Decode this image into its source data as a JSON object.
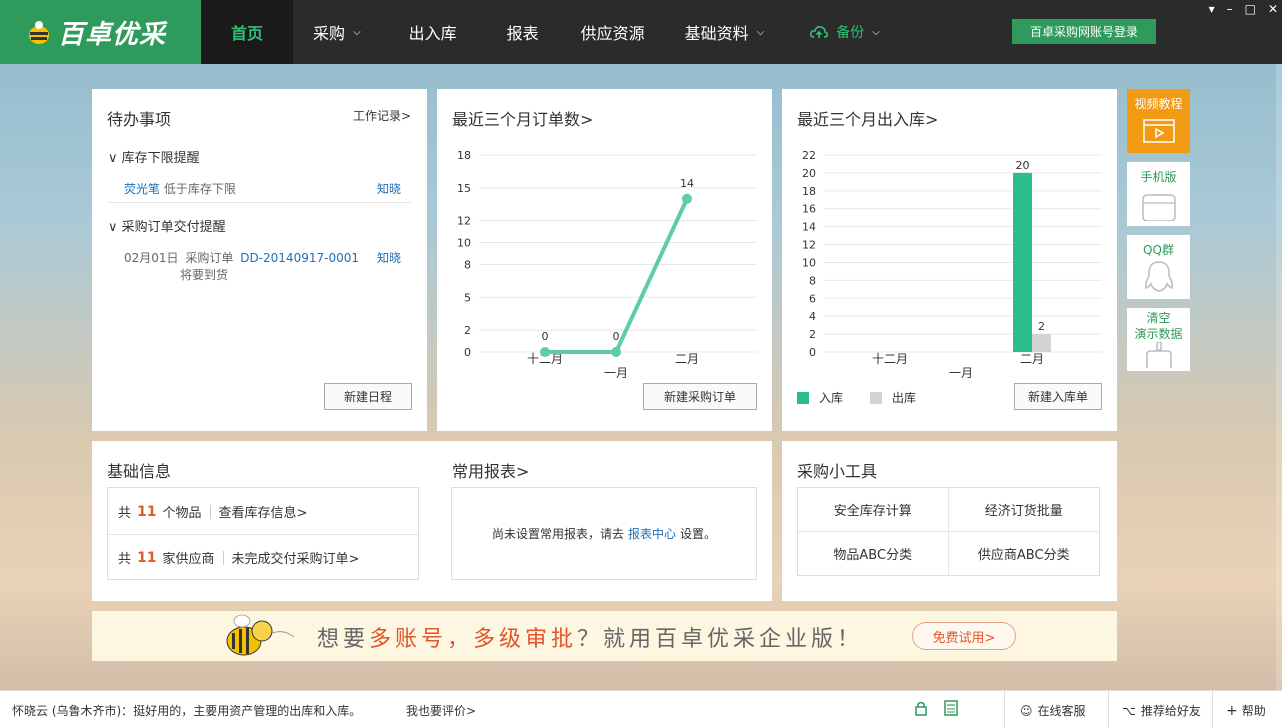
{
  "app": {
    "logo_text": "百卓优采"
  },
  "nav": {
    "items": [
      {
        "label": "首页",
        "active": true
      },
      {
        "label": "采购",
        "dropdown": true
      },
      {
        "label": "出入库"
      },
      {
        "label": "报表"
      },
      {
        "label": "供应资源"
      },
      {
        "label": "基础资料",
        "dropdown": true
      }
    ],
    "backup_label": "备份",
    "login_button": "百卓采购网账号登录"
  },
  "todo": {
    "title": "待办事项",
    "work_log_link": "工作记录>",
    "sections": [
      {
        "label": "库存下限提醒",
        "rows": [
          {
            "item": "荧光笔",
            "text": "低于库存下限",
            "action": "知晓"
          }
        ]
      },
      {
        "label": "采购订单交付提醒",
        "rows": [
          {
            "date": "02月01日",
            "type": "采购订单",
            "order": "DD-20140917-0001",
            "note": "将要到货",
            "action": "知晓"
          }
        ]
      }
    ],
    "new_schedule_button": "新建日程"
  },
  "orders_chart": {
    "title": "最近三个月订单数>",
    "new_button": "新建采购订单",
    "chart_data": {
      "type": "line",
      "categories": [
        "十二月",
        "一月",
        "二月"
      ],
      "values": [
        0,
        0,
        14
      ],
      "yticks": [
        0,
        2,
        5,
        8,
        10,
        12,
        15,
        18
      ],
      "ylim": [
        0,
        18
      ],
      "color": "#5ecda7"
    }
  },
  "stock_chart": {
    "title": "最近三个月出入库>",
    "new_button": "新建入库单",
    "chart_data": {
      "type": "bar",
      "categories": [
        "十二月",
        "一月",
        "二月"
      ],
      "series": [
        {
          "name": "入库",
          "values": [
            0,
            0,
            20
          ],
          "color": "#2bbd8a"
        },
        {
          "name": "出库",
          "values": [
            0,
            0,
            2
          ],
          "color": "#d3d3d3"
        }
      ],
      "yticks": [
        0,
        2,
        4,
        6,
        8,
        10,
        12,
        14,
        16,
        18,
        20,
        22
      ],
      "ylim": [
        0,
        22
      ]
    }
  },
  "side": {
    "video": "视频教程",
    "mobile": "手机版",
    "qq": "QQ群",
    "clear_line1": "清空",
    "clear_line2": "演示数据"
  },
  "basic_info": {
    "title": "基础信息",
    "prefix": "共",
    "item_count": "11",
    "item_unit": "个物品",
    "item_link": "查看库存信息>",
    "supplier_count": "11",
    "supplier_unit": "家供应商",
    "supplier_link": "未完成交付采购订单>"
  },
  "reports": {
    "title": "常用报表>",
    "empty_prefix": "尚未设置常用报表，请去",
    "empty_link": "报表中心",
    "empty_suffix": "设置。"
  },
  "tools": {
    "title": "采购小工具",
    "items": [
      "安全库存计算",
      "经济订货批量",
      "物品ABC分类",
      "供应商ABC分类"
    ]
  },
  "banner": {
    "t1": "想要",
    "t2": "多账号，多级审批",
    "t3": "？就用百卓优采企业版！",
    "trial": "免费试用>"
  },
  "status": {
    "review_user": "怀晓云 (乌鲁木齐市)：",
    "review_text": "挺好用的，主要用资产管理的出库和入库。",
    "review_link": "我也要评价>",
    "online": "在线客服",
    "recommend": "推荐给好友",
    "help": "帮助"
  }
}
